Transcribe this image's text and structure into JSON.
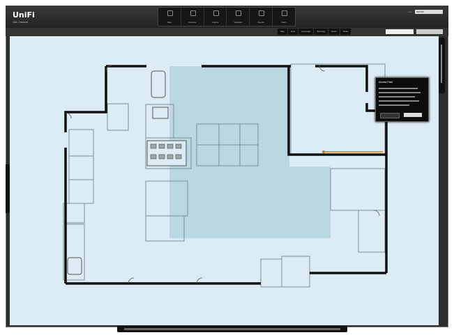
{
  "app": {
    "logo_text": "UniFi",
    "site_label": "Site: Default"
  },
  "topnav": {
    "items": [
      {
        "label": "Map"
      },
      {
        "label": "Devices"
      },
      {
        "label": "Clients"
      },
      {
        "label": "Statistics"
      },
      {
        "label": "Events"
      },
      {
        "label": "Alerts"
      }
    ]
  },
  "user": {
    "label": "User",
    "value": "admin"
  },
  "subnav": {
    "tabs": [
      {
        "label": "Map"
      },
      {
        "label": "Lock"
      },
      {
        "label": "Coverage"
      },
      {
        "label": "Topology"
      },
      {
        "label": "Zoom"
      },
      {
        "label": "Scale"
      }
    ]
  },
  "popup": {
    "title": "Access Point",
    "ok_label": "OK",
    "cancel_label": "Cancel"
  },
  "colors": {
    "map_bg": "#dcecf4",
    "room_highlight": "#b8d8e2",
    "wall": "#111111",
    "thin_line": "#7a8a90",
    "orange_line": "#e8902a",
    "ui_dark": "#2d2d2d"
  }
}
